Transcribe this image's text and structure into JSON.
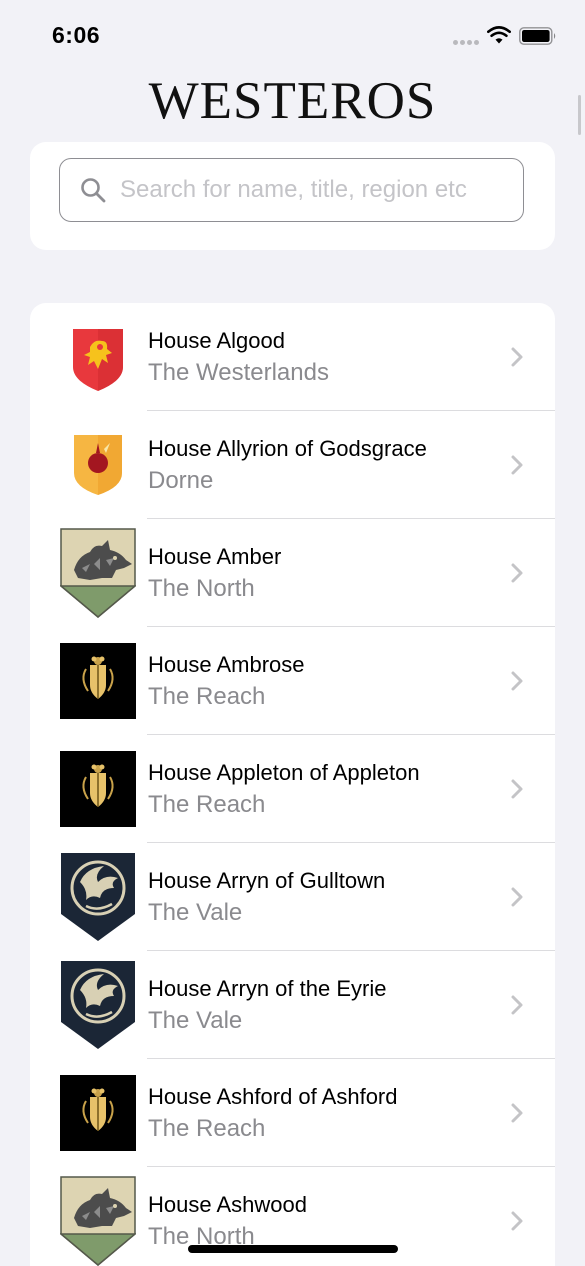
{
  "status_bar": {
    "time": "6:06"
  },
  "app": {
    "title": "WESTEROS"
  },
  "search": {
    "placeholder": "Search for name, title, region etc",
    "value": ""
  },
  "houses": [
    {
      "name": "House Algood",
      "region": "The Westerlands",
      "sigil": "red-lion-shield-icon"
    },
    {
      "name": "House Allyrion of Godsgrace",
      "region": "Dorne",
      "sigil": "orange-sun-shield-icon"
    },
    {
      "name": "House Amber",
      "region": "The North",
      "sigil": "direwolf-shield-icon"
    },
    {
      "name": "House Ambrose",
      "region": "The Reach",
      "sigil": "golden-rose-shield-icon"
    },
    {
      "name": "House Appleton of Appleton",
      "region": "The Reach",
      "sigil": "golden-rose-shield-icon"
    },
    {
      "name": "House Arryn of Gulltown",
      "region": "The Vale",
      "sigil": "falcon-moon-shield-icon"
    },
    {
      "name": "House Arryn of the Eyrie",
      "region": "The Vale",
      "sigil": "falcon-moon-shield-icon"
    },
    {
      "name": "House Ashford of Ashford",
      "region": "The Reach",
      "sigil": "golden-rose-shield-icon"
    },
    {
      "name": "House Ashwood",
      "region": "The North",
      "sigil": "direwolf-shield-icon"
    }
  ],
  "colors": {
    "background": "#f2f2f7",
    "card": "#ffffff",
    "secondary_text": "#8a8a8e",
    "chevron": "#c4c4c7"
  }
}
